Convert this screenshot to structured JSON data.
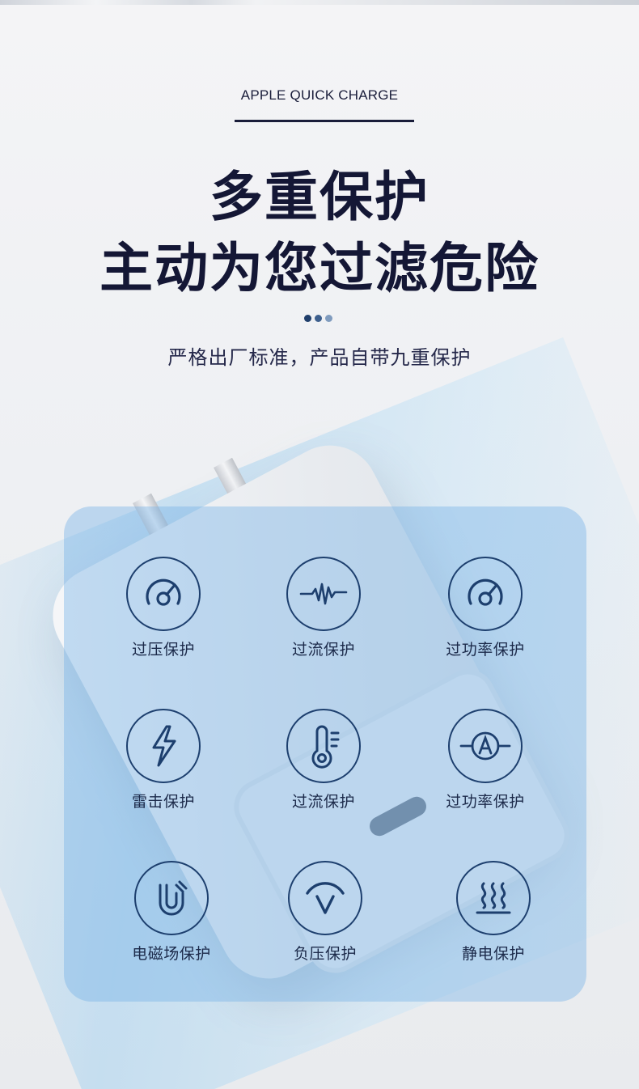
{
  "header": {
    "eyebrow": "APPLE QUICK CHARGE",
    "headline_line1": "多重保护",
    "headline_line2": "主动为您过滤危险",
    "subtitle": "严格出厂标准，产品自带九重保护"
  },
  "dots": [
    {
      "color": "#1f3e6b"
    },
    {
      "color": "#3d5f8d"
    },
    {
      "color": "#7f9bbe"
    }
  ],
  "features": [
    {
      "label": "过压保护",
      "icon": "gauge-icon"
    },
    {
      "label": "过流保护",
      "icon": "waveform-icon"
    },
    {
      "label": "过功率保护",
      "icon": "gauge-icon"
    },
    {
      "label": "雷击保护",
      "icon": "lightning-icon"
    },
    {
      "label": "过流保护",
      "icon": "thermometer-icon"
    },
    {
      "label": "过功率保护",
      "icon": "ammeter-icon"
    },
    {
      "label": "电磁场保护",
      "icon": "magnet-icon"
    },
    {
      "label": "负压保护",
      "icon": "negative-voltage-icon"
    },
    {
      "label": "静电保护",
      "icon": "static-heat-icon"
    }
  ],
  "colors": {
    "headline": "#141735",
    "accent": "#1d3f6e",
    "card": "#78b2e6"
  }
}
